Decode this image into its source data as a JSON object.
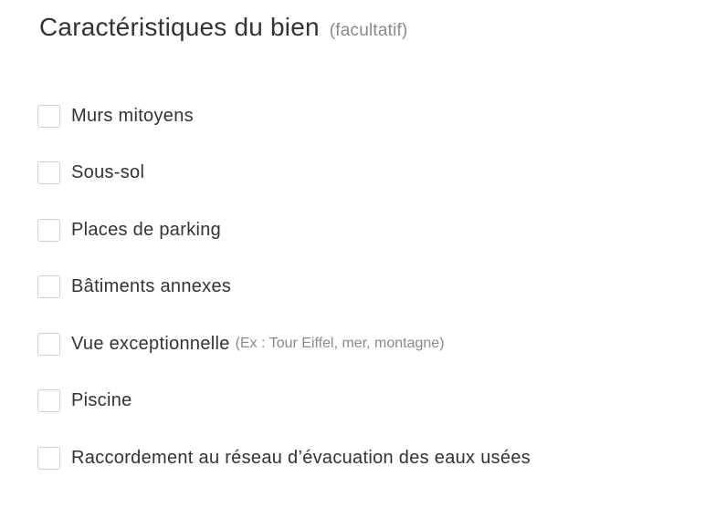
{
  "section": {
    "title": "Caractéristiques du bien",
    "optional": "(facultatif)"
  },
  "options": [
    {
      "label": "Murs mitoyens",
      "hint": "",
      "checked": false
    },
    {
      "label": "Sous-sol",
      "hint": "",
      "checked": false
    },
    {
      "label": "Places de parking",
      "hint": "",
      "checked": false
    },
    {
      "label": "Bâtiments annexes",
      "hint": "",
      "checked": false
    },
    {
      "label": "Vue exceptionnelle",
      "hint": "(Ex : Tour Eiffel, mer, montagne)",
      "checked": false
    },
    {
      "label": "Piscine",
      "hint": "",
      "checked": false
    },
    {
      "label": "Raccordement au réseau d’évacuation des eaux usées",
      "hint": "",
      "checked": false
    }
  ]
}
